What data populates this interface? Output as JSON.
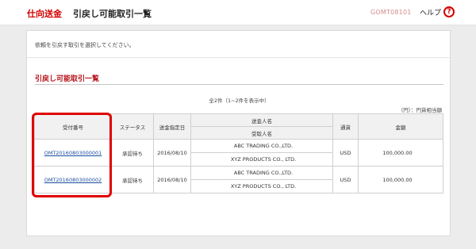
{
  "header": {
    "section": "仕向送金",
    "title": "引戻し可能取引一覧",
    "screen_code": "GOMT08101",
    "help_label": "ヘルプ",
    "help_icon": "question-icon"
  },
  "instruction": "依頼を引戻す取引を選択してください。",
  "section_title": "引戻し可能取引一覧",
  "count_text": "全2件（1~2件を表示中）",
  "unit_note": "（円）：円貨相当額",
  "table": {
    "headers": {
      "receipt_no": "受付番号",
      "status": "ステータス",
      "date": "送金指定日",
      "remitter": "送金人名",
      "beneficiary": "受取人名",
      "currency": "通貨",
      "amount": "金額"
    },
    "rows": [
      {
        "receipt_no": "OMT20160803000001",
        "status": "承認待ち",
        "date": "2016/08/10",
        "remitter": "ABC TRADING CO.,LTD.",
        "beneficiary": "XYZ PRODUCTS CO., LTD.",
        "currency": "USD",
        "amount": "100,000.00"
      },
      {
        "receipt_no": "OMT20160803000002",
        "status": "承認待ち",
        "date": "2016/08/10",
        "remitter": "ABC TRADING CO.,LTD.",
        "beneficiary": "XYZ PRODUCTS CO., LTD.",
        "currency": "USD",
        "amount": "100,000.00"
      }
    ]
  },
  "colors": {
    "brand_red": "#d40000",
    "highlight": "#e00000",
    "link": "#1a4d9e"
  }
}
